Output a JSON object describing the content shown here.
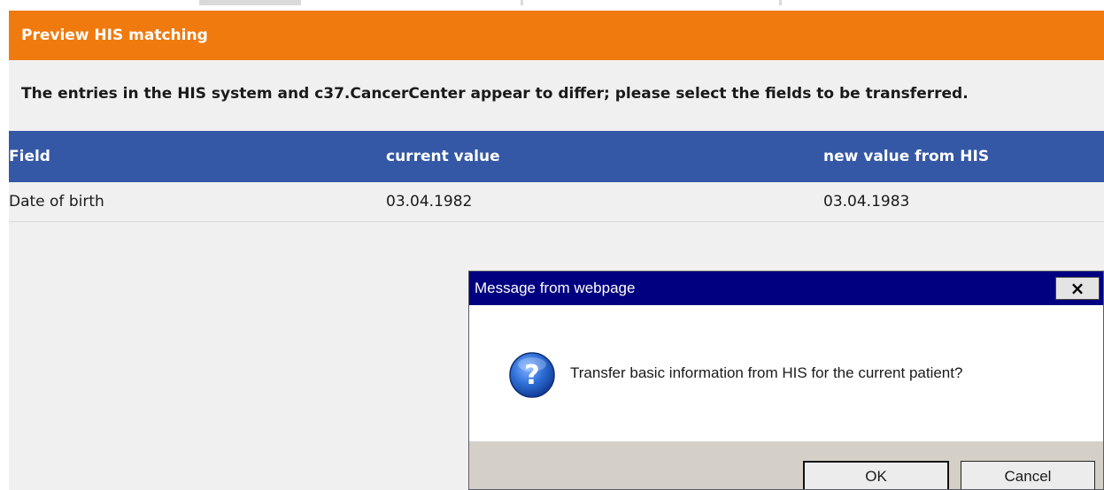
{
  "panel": {
    "title": "Preview HIS matching",
    "message": "The entries in the HIS system and c37.CancerCenter appear to differ; please select the fields to be transferred."
  },
  "table": {
    "columns": [
      "Field",
      "current value",
      "new value from HIS"
    ],
    "rows": [
      [
        "Date of birth",
        "03.04.1982",
        "03.04.1983"
      ]
    ]
  },
  "dialog": {
    "title": "Message from webpage",
    "close_label": "×",
    "icon": "question-icon",
    "text": "Transfer basic information from HIS for the current patient?",
    "ok_label": "OK",
    "cancel_label": "Cancel"
  },
  "colors": {
    "header_orange": "#f07a0e",
    "table_header_blue": "#3458a5",
    "dialog_title_navy": "#000080",
    "panel_background": "#f0f0f0"
  }
}
